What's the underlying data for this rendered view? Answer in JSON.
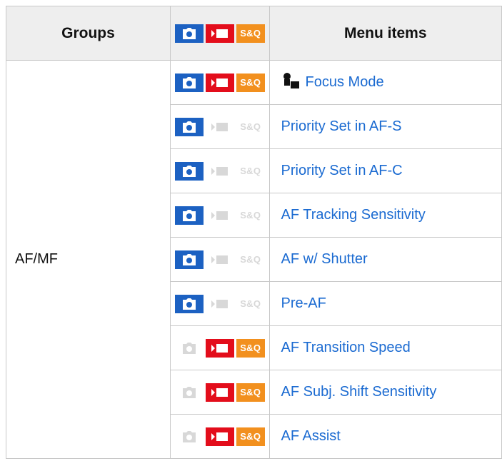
{
  "header": {
    "groups_label": "Groups",
    "menu_items_label": "Menu items",
    "icons": {
      "photo": true,
      "movie": true,
      "snq": true
    }
  },
  "snq_label": "S&Q",
  "group": {
    "label": "AF/MF"
  },
  "colors": {
    "photo_on": "#1c61c2",
    "movie_on": "#e30d1b",
    "snq_on": "#f2901e",
    "off": "#d8d8d8",
    "link": "#1a6ad1"
  },
  "rows": [
    {
      "label": "Focus Mode",
      "icon": "custom-key-icon",
      "photo": true,
      "movie": true,
      "snq": true
    },
    {
      "label": "Priority Set in AF-S",
      "photo": true,
      "movie": false,
      "snq": false
    },
    {
      "label": "Priority Set in AF-C",
      "photo": true,
      "movie": false,
      "snq": false
    },
    {
      "label": "AF Tracking Sensitivity",
      "photo": true,
      "movie": false,
      "snq": false
    },
    {
      "label": "AF w/ Shutter",
      "photo": true,
      "movie": false,
      "snq": false
    },
    {
      "label": "Pre-AF",
      "photo": true,
      "movie": false,
      "snq": false
    },
    {
      "label": "AF Transition Speed",
      "photo": false,
      "movie": true,
      "snq": true
    },
    {
      "label": "AF Subj. Shift Sensitivity",
      "photo": false,
      "movie": true,
      "snq": true
    },
    {
      "label": "AF Assist",
      "photo": false,
      "movie": true,
      "snq": true
    }
  ]
}
